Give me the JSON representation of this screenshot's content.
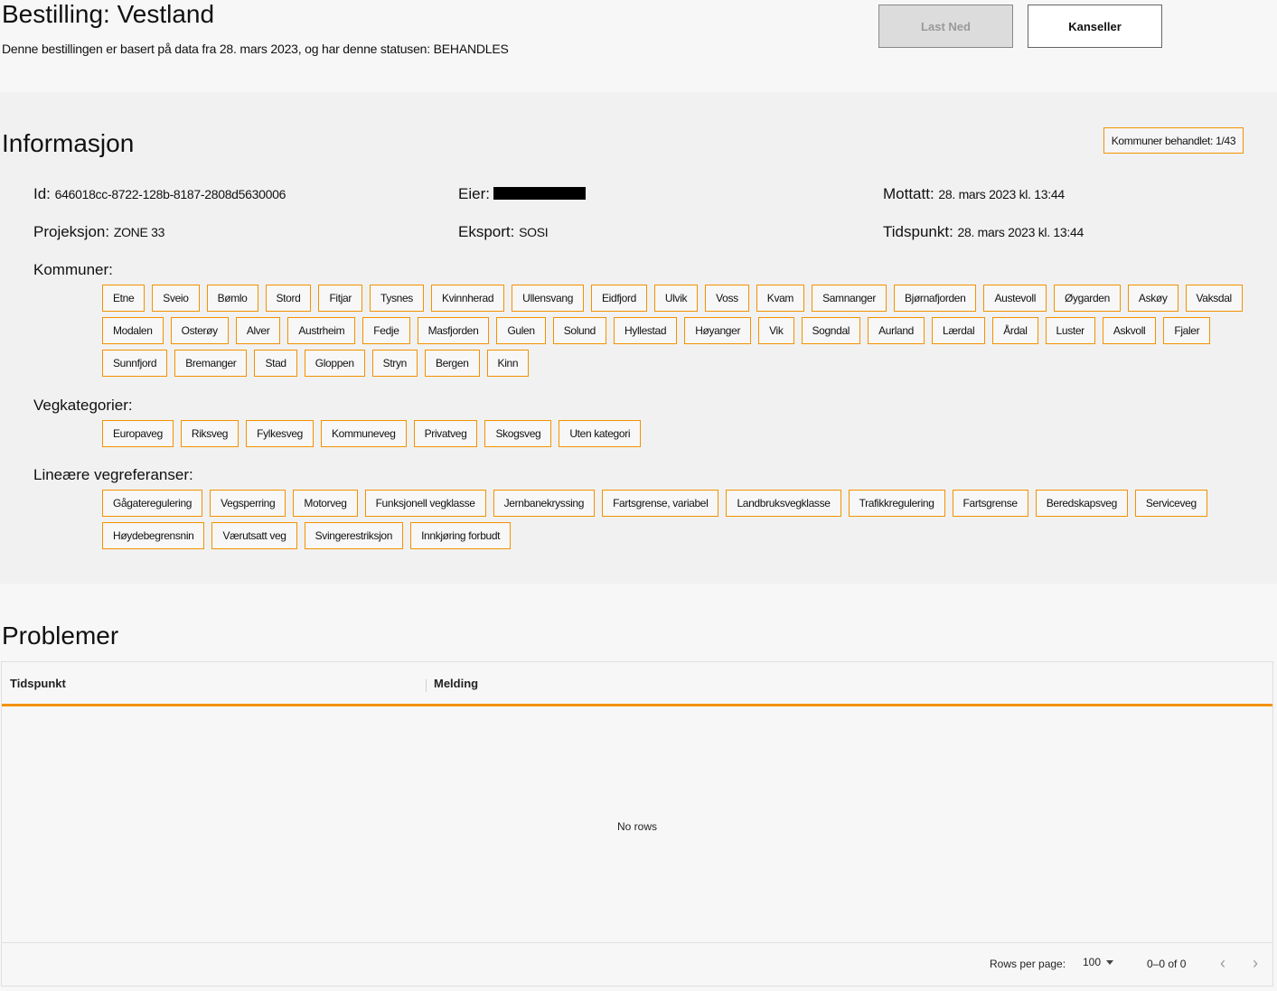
{
  "header": {
    "title": "Bestilling: Vestland",
    "subtitle": "Denne bestillingen er basert på data fra 28. mars 2023, og har denne statusen: BEHANDLES",
    "download_label": "Last Ned",
    "cancel_label": "Kanseller"
  },
  "info": {
    "heading": "Informasjon",
    "counter": "Kommuner behandlet: 1/43",
    "id_label": "Id:",
    "id_value": "646018cc-8722-128b-8187-2808d5630006",
    "owner_label": "Eier:",
    "received_label": "Mottatt:",
    "received_value": "28. mars 2023 kl. 13:44",
    "projection_label": "Projeksjon:",
    "projection_value": "ZONE 33",
    "export_label": "Eksport:",
    "export_value": "SOSI",
    "time_label": "Tidspunkt:",
    "time_value": "28. mars 2023 kl. 13:44",
    "kommuner_label": "Kommuner:",
    "kommuner": [
      "Etne",
      "Sveio",
      "Bømlo",
      "Stord",
      "Fitjar",
      "Tysnes",
      "Kvinnherad",
      "Ullensvang",
      "Eidfjord",
      "Ulvik",
      "Voss",
      "Kvam",
      "Samnanger",
      "Bjørnafjorden",
      "Austevoll",
      "Øygarden",
      "Askøy",
      "Vaksdal",
      "Modalen",
      "Osterøy",
      "Alver",
      "Austrheim",
      "Fedje",
      "Masfjorden",
      "Gulen",
      "Solund",
      "Hyllestad",
      "Høyanger",
      "Vik",
      "Sogndal",
      "Aurland",
      "Lærdal",
      "Årdal",
      "Luster",
      "Askvoll",
      "Fjaler",
      "Sunnfjord",
      "Bremanger",
      "Stad",
      "Gloppen",
      "Stryn",
      "Bergen",
      "Kinn"
    ],
    "vegkategorier_label": "Vegkategorier:",
    "vegkategorier": [
      "Europaveg",
      "Riksveg",
      "Fylkesveg",
      "Kommuneveg",
      "Privatveg",
      "Skogsveg",
      "Uten kategori"
    ],
    "lineare_label": "Lineære vegreferanser:",
    "lineare": [
      "Gågateregulering",
      "Vegsperring",
      "Motorveg",
      "Funksjonell vegklasse",
      "Jernbanekryssing",
      "Fartsgrense, variabel",
      "Landbruksvegklasse",
      "Trafikkregulering",
      "Fartsgrense",
      "Beredskapsveg",
      "Serviceveg",
      "Høydebegrensnin",
      "Værutsatt veg",
      "Svingerestriksjon",
      "Innkjøring forbudt"
    ]
  },
  "problems": {
    "heading": "Problemer",
    "col_time": "Tidspunkt",
    "col_message": "Melding",
    "empty": "No rows",
    "rows_per_page_label": "Rows per page:",
    "rows_per_page": "100",
    "range": "0–0 of 0",
    "prev_icon": "‹",
    "next_icon": "›"
  },
  "colors": {
    "accent": "#f39200"
  }
}
